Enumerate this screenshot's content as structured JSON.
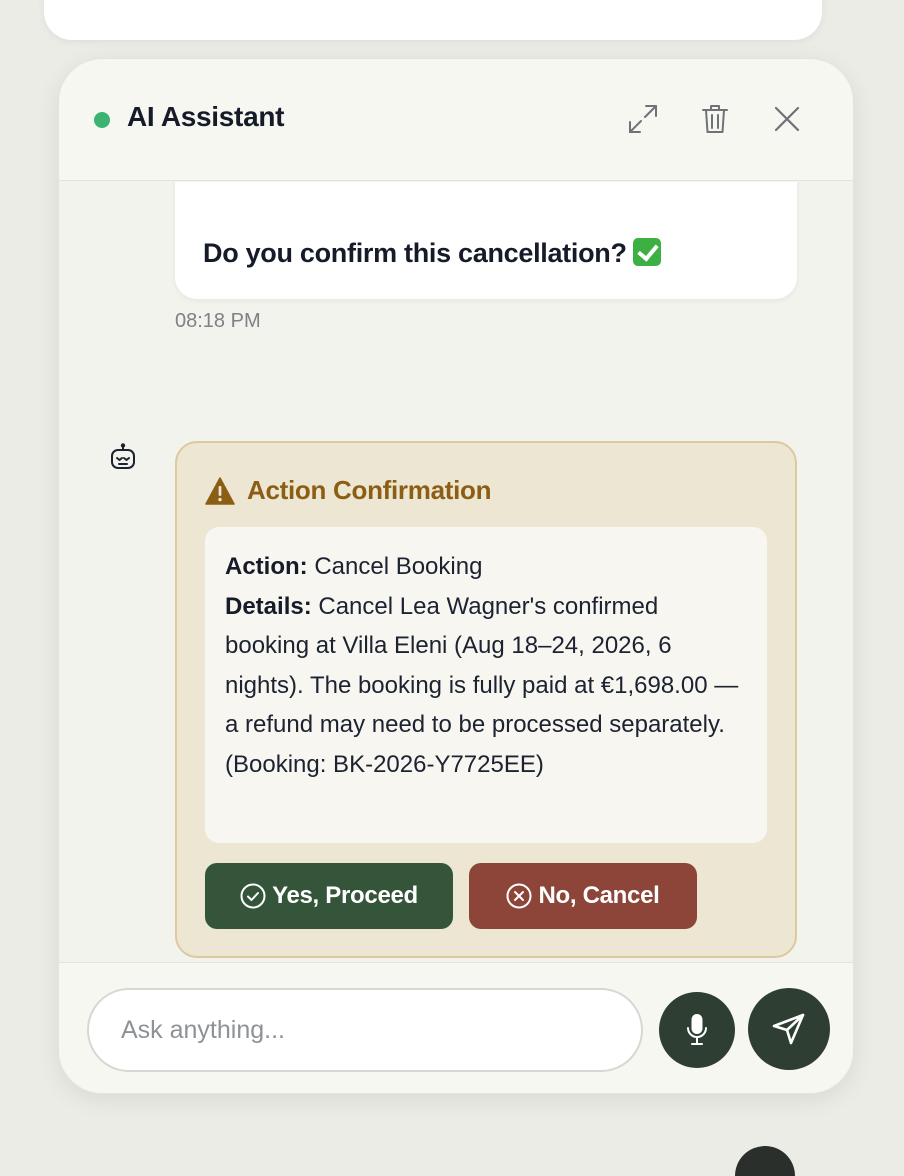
{
  "header": {
    "title": "AI Assistant",
    "status_color": "#3cb371",
    "icons": [
      "expand-icon",
      "trash-icon",
      "close-icon"
    ]
  },
  "previous_message": {
    "question": "Do you confirm this cancellation?",
    "emoji": "check-mark-button-emoji",
    "time": "08:18 PM"
  },
  "confirmation": {
    "title": "Action Confirmation",
    "action_label": "Action:",
    "action_value": "Cancel Booking",
    "details_label": "Details:",
    "details_value": "Cancel Lea Wagner's confirmed booking at Villa Eleni (Aug 18–24, 2026, 6 nights). The booking is fully paid at €1,698.00 — a refund may need to be processed separately. (Booking: BK-2026-Y7725EE)",
    "yes_label": "Yes, Proceed",
    "no_label": "No, Cancel",
    "colors": {
      "title": "#8b5e14",
      "yes": "#35553a",
      "no": "#8c4538"
    }
  },
  "composer": {
    "placeholder": "Ask anything..."
  }
}
